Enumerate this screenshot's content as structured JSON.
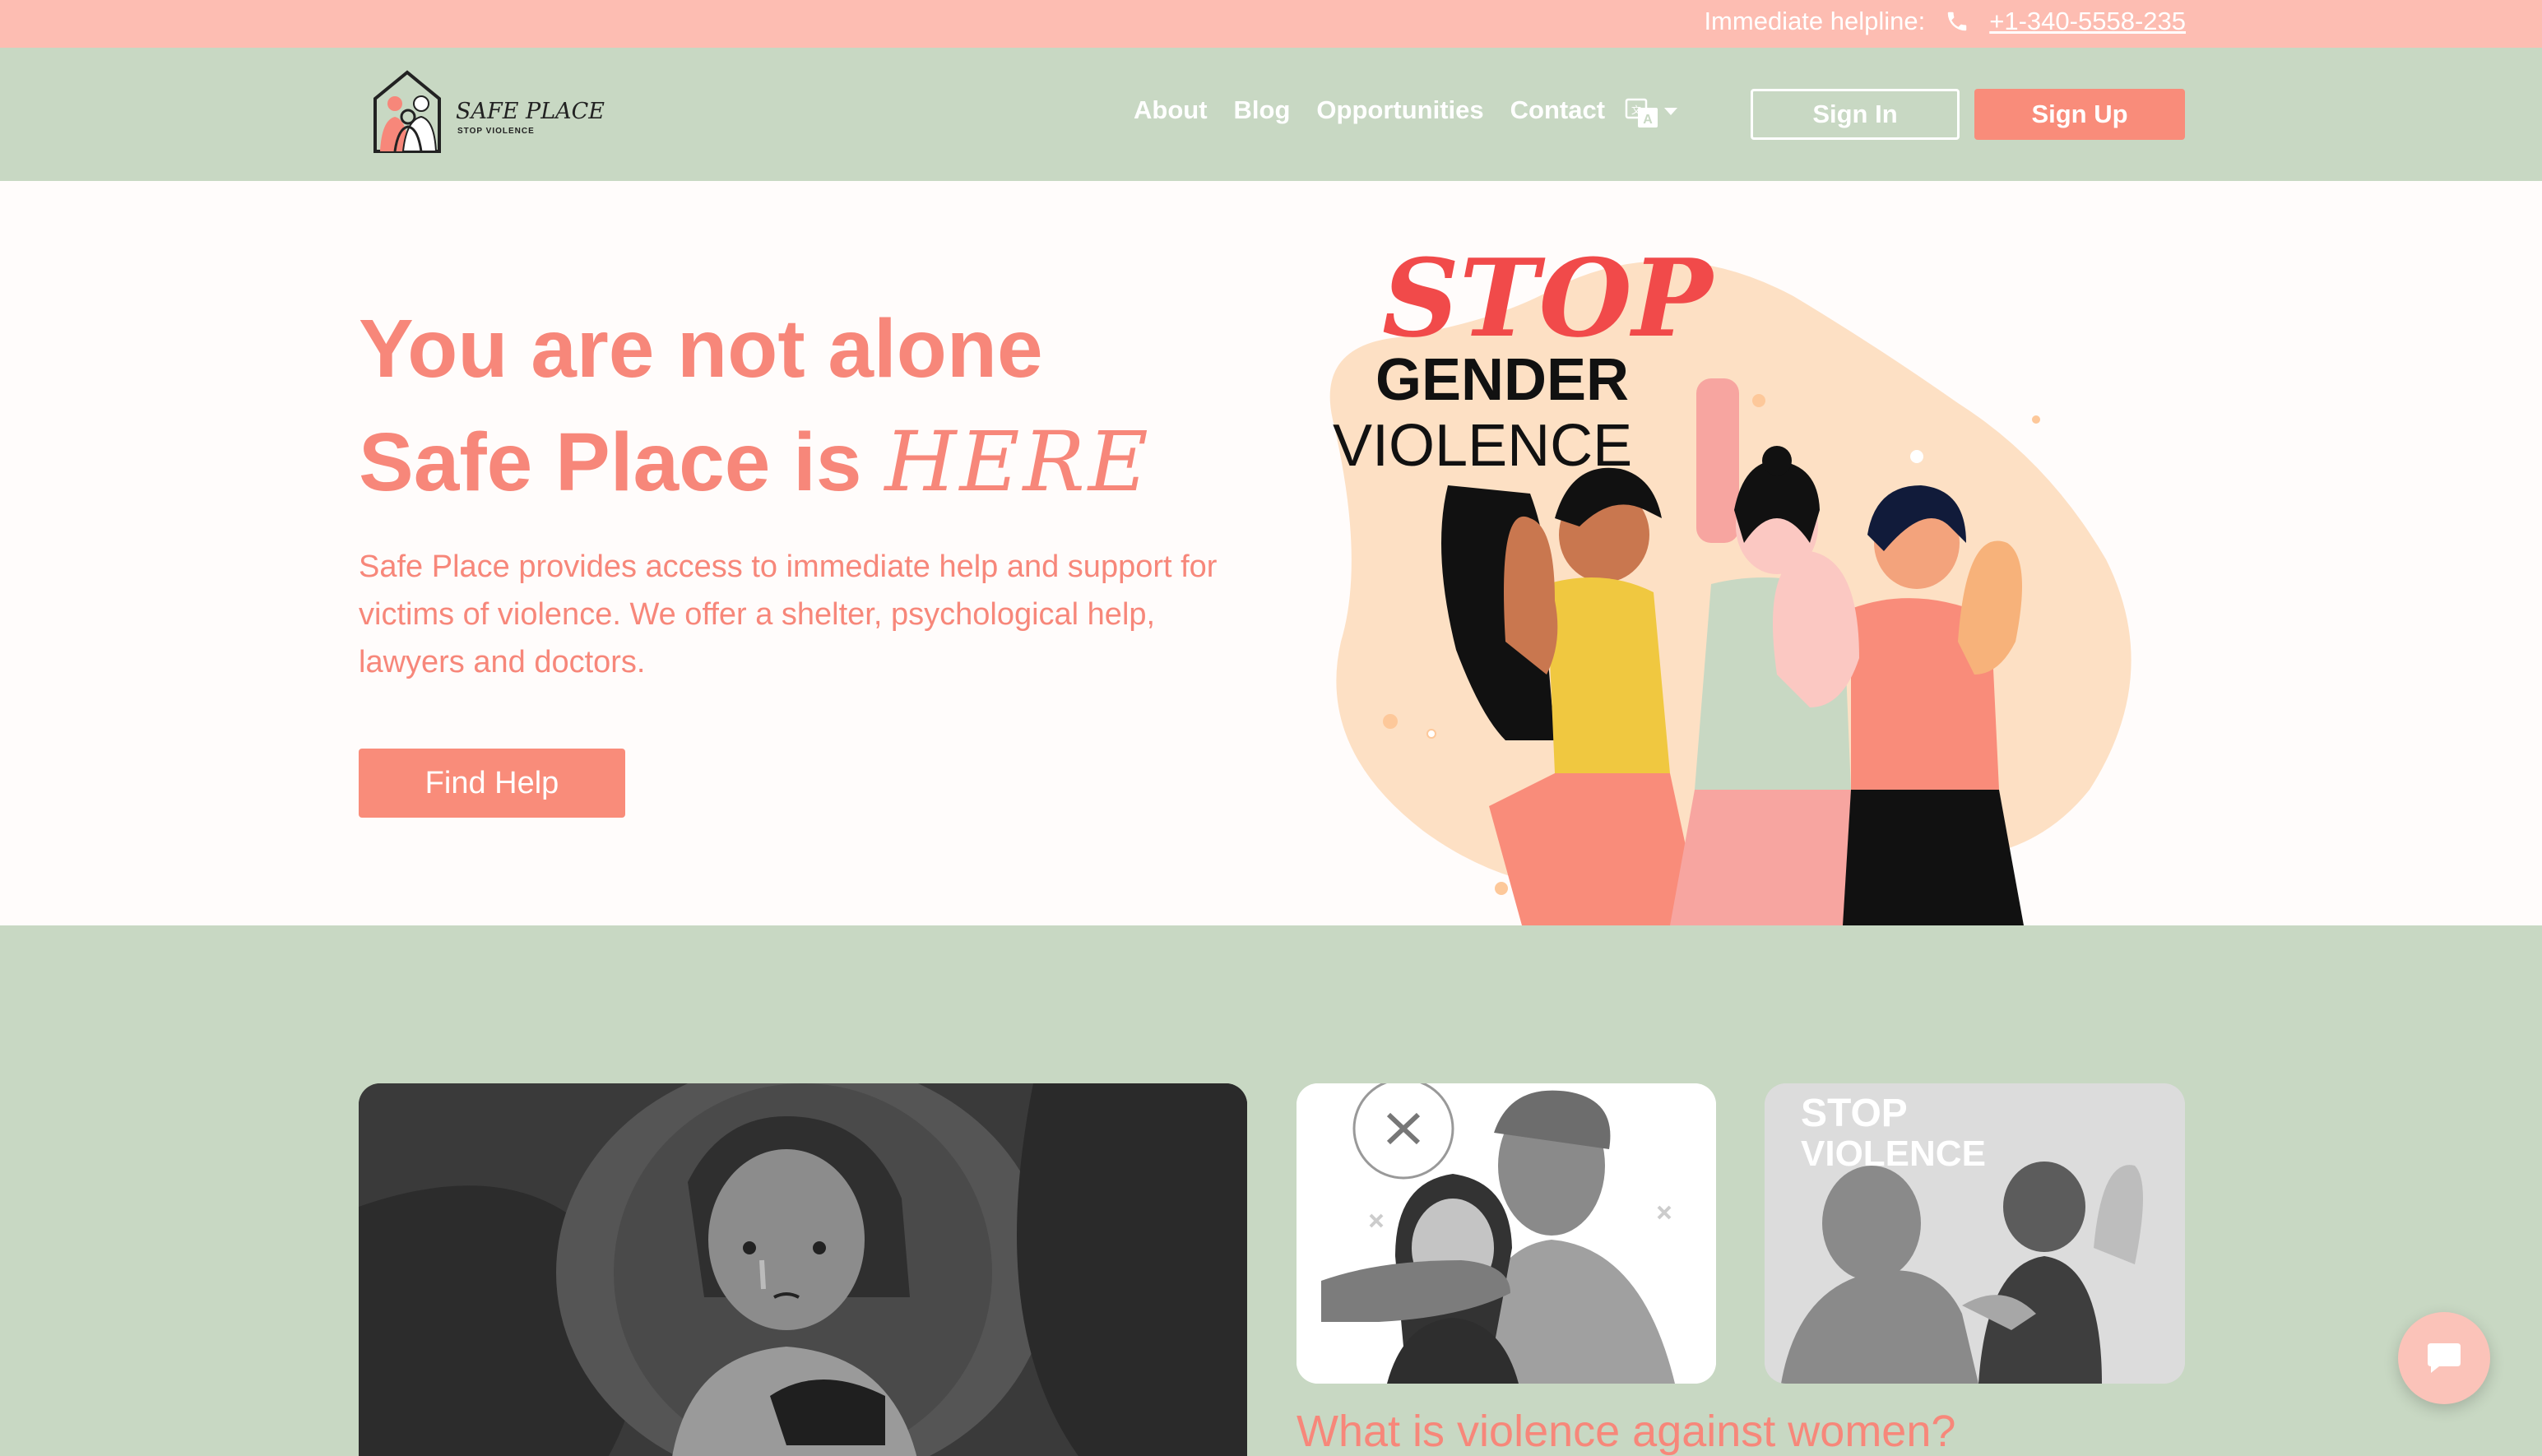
{
  "topbar": {
    "helpline_label": "Immediate helpline:",
    "helpline_phone": "+1-340-5558-235",
    "phone_icon": "phone-icon"
  },
  "navbar": {
    "logo_title": "SAFE PLACE",
    "logo_subtitle": "STOP VIOLENCE",
    "links": [
      "About",
      "Blog",
      "Opportunities",
      "Contact"
    ],
    "language_icon": "translate-icon",
    "signin_label": "Sign In",
    "signup_label": "Sign Up"
  },
  "hero": {
    "title_line1": "You are not alone",
    "title_line2_prefix": "Safe Place is ",
    "title_line2_emphasis": "HERE",
    "description": "Safe Place provides access to immediate help and support for victims of violence. We offer a shelter, psychological help, lawyers and doctors.",
    "find_help_label": "Find Help",
    "illustration": {
      "stop": "STOP",
      "gender": "GENDER",
      "violence": "VIOLENCE"
    }
  },
  "section2": {
    "card_right_text_1": "STOP",
    "card_right_text_2": "VIOLENCE",
    "heading": "What is violence against women?"
  },
  "chat": {
    "icon": "chat-icon"
  },
  "colors": {
    "topbar": "#fdbdb2",
    "navbar": "#c8d8c3",
    "accent": "#f98c7a",
    "text_accent": "#f7877a"
  }
}
